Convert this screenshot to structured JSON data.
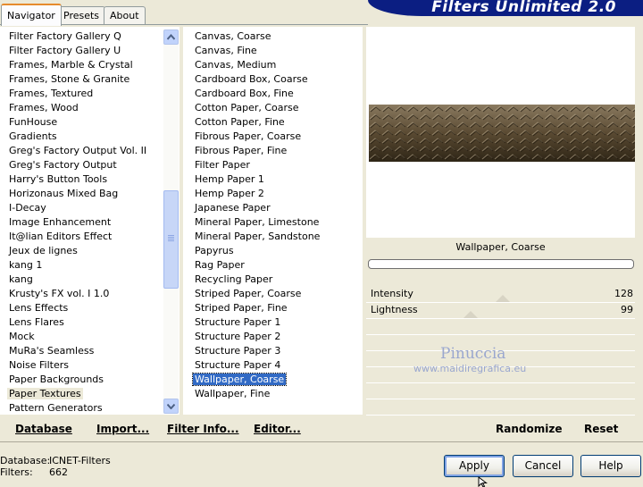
{
  "tabs": [
    "Navigator",
    "Presets",
    "About"
  ],
  "title": "Filters Unlimited 2.0",
  "categories": [
    "Filter Factory Gallery Q",
    "Filter Factory Gallery U",
    "Frames, Marble & Crystal",
    "Frames, Stone & Granite",
    "Frames, Textured",
    "Frames, Wood",
    "FunHouse",
    "Gradients",
    "Greg's Factory Output Vol. II",
    "Greg's Factory Output",
    "Harry's Button Tools",
    "Horizonaus Mixed Bag",
    "I-Decay",
    "Image Enhancement",
    "It@lian Editors Effect",
    "Jeux de lignes",
    "kang 1",
    "kang",
    "Krusty's FX vol. I 1.0",
    "Lens Effects",
    "Lens Flares",
    "Mock",
    "MuRa's Seamless",
    "Noise Filters",
    "Paper Backgrounds",
    "Paper Textures",
    "Pattern Generators"
  ],
  "filters": [
    "Canvas, Coarse",
    "Canvas, Fine",
    "Canvas, Medium",
    "Cardboard Box, Coarse",
    "Cardboard Box, Fine",
    "Cotton Paper, Coarse",
    "Cotton Paper, Fine",
    "Fibrous Paper, Coarse",
    "Fibrous Paper, Fine",
    "Filter Paper",
    "Hemp Paper 1",
    "Hemp Paper 2",
    "Japanese Paper",
    "Mineral Paper, Limestone",
    "Mineral Paper, Sandstone",
    "Papyrus",
    "Rag Paper",
    "Recycling Paper",
    "Striped Paper, Coarse",
    "Striped Paper, Fine",
    "Structure Paper 1",
    "Structure Paper 2",
    "Structure Paper 3",
    "Structure Paper 4",
    "Wallpaper, Coarse",
    "Wallpaper, Fine"
  ],
  "selected_category": "Paper Textures",
  "selected_filter": "Wallpaper, Coarse",
  "links": {
    "database": "Database",
    "import": "Import...",
    "filter_info": "Filter Info...",
    "editor": "Editor..."
  },
  "preview_filter_name": "Wallpaper, Coarse",
  "controls": [
    {
      "label": "Intensity",
      "value": "128",
      "level": 0.5
    },
    {
      "label": "Lightness",
      "value": "99",
      "level": 0.39
    }
  ],
  "watermark": {
    "name": "Pinuccia",
    "url": "www.maidiregrafica.eu"
  },
  "right_links": {
    "randomize": "Randomize",
    "reset": "Reset"
  },
  "info": {
    "database_label": "Database:",
    "database_value": "ICNET-Filters",
    "filters_label": "Filters:",
    "filters_value": "662"
  },
  "buttons": {
    "apply": "Apply",
    "cancel": "Cancel",
    "help": "Help"
  },
  "colors": {
    "accent_blue": "#316ac5",
    "banner_blue": "#0b1e82",
    "tab_orange": "#e68b2c"
  }
}
